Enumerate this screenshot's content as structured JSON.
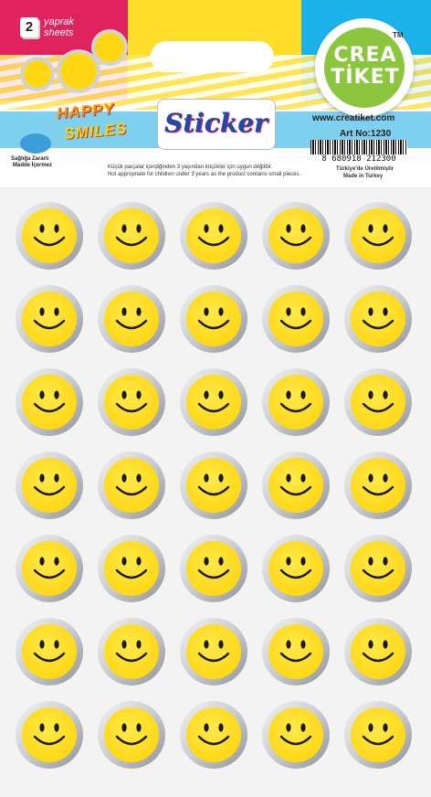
{
  "header": {
    "sheet_count": "2",
    "sheet_label_tr": "yaprak",
    "sheet_label_en": "sheets",
    "brand_line1": "CREA",
    "brand_line2": "TİKET",
    "trademark": "TM",
    "product_line1": "HAPPY",
    "product_line2": "SMILES",
    "sticker_word": "Sticker",
    "nontoxic_line1": "Sağlığa Zararlı",
    "nontoxic_line2": "Madde İçermez",
    "website": "www.creatiket.com",
    "art_no": "Art No:1230",
    "barcode": "8 680918 212300",
    "warning_tr": "Küçük parçalar içerdiğinden 3 yaşından küçükler için uygun değildir.",
    "warning_en": "Not appropriate for children under 3 years as the product contains small pieces.",
    "made_tr": "Türkiye'de Üretilmiştir",
    "made_en": "Made in Turkey"
  },
  "grid": {
    "rows": 7,
    "cols": 5,
    "icon": "smiley-face-icon"
  },
  "colors": {
    "face": "#ffd714",
    "ring": "#c9ccd0",
    "pink": "#e0235f",
    "yellow": "#ffde2a",
    "blue": "#1cb3ea",
    "brand_green": "#8cc63f"
  }
}
